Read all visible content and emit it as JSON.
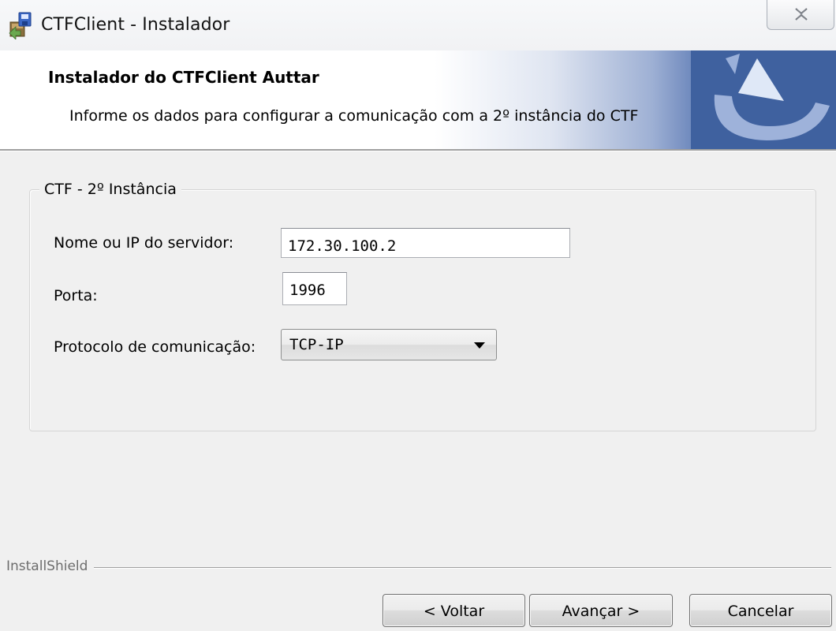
{
  "window": {
    "title": "CTFClient - Instalador",
    "icons": {
      "app": "installer-icon",
      "close": "close-icon"
    }
  },
  "banner": {
    "title": "Instalador do CTFClient Auttar",
    "subtitle": "Informe os dados para configurar a comunicação com a 2º instância do CTF",
    "logo_icon": "installshield-logo-icon"
  },
  "group": {
    "legend": "CTF - 2º Instância",
    "server_label": "Nome ou IP do servidor:",
    "server_value": "172.30.100.2",
    "port_label": "Porta:",
    "port_value": "1996",
    "protocol_label": "Protocolo de comunicação:",
    "protocol_value": "TCP-IP"
  },
  "footer": {
    "brand": "InstallShield",
    "back_label": "< Voltar",
    "next_label": "Avançar >",
    "cancel_label": "Cancelar"
  },
  "colors": {
    "window_bg": "#f0f0f0",
    "banner_blue": "#3f619f",
    "input_border": "#abadb3"
  }
}
